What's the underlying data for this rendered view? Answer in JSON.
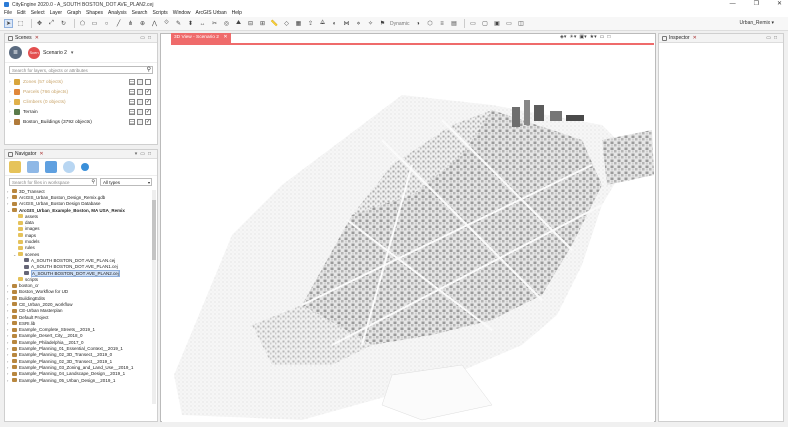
{
  "window": {
    "title": "CityEngine 2020.0 - A_SOUTH BOSTON_DOT AVE_PLAN2.cej",
    "minimize": "—",
    "maximize": "❐",
    "close": "✕"
  },
  "menu": [
    "File",
    "Edit",
    "Select",
    "Layer",
    "Graph",
    "Shapes",
    "Analysis",
    "Search",
    "Scripts",
    "Window",
    "ArcGIS Urban",
    "Help"
  ],
  "toolbar": {
    "dynamic_label": "Dynamic",
    "user_label": "Urban_Remix ▾"
  },
  "scenes_panel": {
    "title": "Scenes",
    "badge": "Scen",
    "scenario": "Scenario 2",
    "search_placeholder": "Search for layers, objects or attributes",
    "layers": [
      {
        "name": "Zones (57 objects)",
        "dim": true,
        "color": "#d8a53c"
      },
      {
        "name": "Parcels (766 objects)",
        "dim": true,
        "color": "#e0873a"
      },
      {
        "name": "Climbers (0 objects)",
        "dim": true,
        "color": "#e0b04a"
      },
      {
        "name": "Terrain",
        "dim": false,
        "color": "#5a7a4a"
      },
      {
        "name": "Boston_Buildings (3792 objects)",
        "dim": false,
        "color": "#b07a3a"
      }
    ]
  },
  "navigator_panel": {
    "title": "Navigator",
    "search_placeholder": "Search for files in workspace",
    "filter": "All types",
    "tree": [
      {
        "label": "3D_Transect",
        "level": 0,
        "exp": "›",
        "icon": "proj"
      },
      {
        "label": "ArcGIS_Urban_Boston_Design_Remix.gdb",
        "level": 0,
        "exp": "›",
        "icon": "proj"
      },
      {
        "label": "ArcGIS_Urban_Boston Design Database",
        "level": 0,
        "exp": "›",
        "icon": "proj"
      },
      {
        "label": "ArcGIS_Urban_Example_Boston, MA USA_Remix",
        "level": 0,
        "exp": "⌄",
        "icon": "proj",
        "bold": true
      },
      {
        "label": "assets",
        "level": 1,
        "exp": "",
        "icon": "folder"
      },
      {
        "label": "data",
        "level": 1,
        "exp": "",
        "icon": "folder"
      },
      {
        "label": "images",
        "level": 1,
        "exp": "",
        "icon": "folder"
      },
      {
        "label": "maps",
        "level": 1,
        "exp": "",
        "icon": "folder"
      },
      {
        "label": "models",
        "level": 1,
        "exp": "",
        "icon": "folder"
      },
      {
        "label": "rules",
        "level": 1,
        "exp": "",
        "icon": "folder"
      },
      {
        "label": "scenes",
        "level": 1,
        "exp": "⌄",
        "icon": "folder"
      },
      {
        "label": "A_SOUTH BOSTON_DOT AVE_PLAN.cej",
        "level": 2,
        "exp": "",
        "icon": "file"
      },
      {
        "label": "A_SOUTH BOSTON_DOT AVE_PLAN1.cej",
        "level": 2,
        "exp": "",
        "icon": "file"
      },
      {
        "label": "A_SOUTH BOSTON_DOT AVE_PLAN2.cej",
        "level": 2,
        "exp": "",
        "icon": "file",
        "selected": true
      },
      {
        "label": "scripts",
        "level": 1,
        "exp": "",
        "icon": "folder"
      },
      {
        "label": "boston_cr",
        "level": 0,
        "exp": "›",
        "icon": "proj"
      },
      {
        "label": "Boston_Workflow for UD",
        "level": 0,
        "exp": "›",
        "icon": "proj"
      },
      {
        "label": "BuildingEdits",
        "level": 0,
        "exp": "›",
        "icon": "proj"
      },
      {
        "label": "CE_Urban_2020_workflow",
        "level": 0,
        "exp": "›",
        "icon": "proj"
      },
      {
        "label": "CE-Urban Masterplan",
        "level": 0,
        "exp": "›",
        "icon": "proj"
      },
      {
        "label": "Default Project",
        "level": 0,
        "exp": "›",
        "icon": "proj"
      },
      {
        "label": "ESRI.lib",
        "level": 0,
        "exp": "›",
        "icon": "proj"
      },
      {
        "label": "Example_Complete_Streets__2019_1",
        "level": 0,
        "exp": "›",
        "icon": "proj"
      },
      {
        "label": "Example_Desert_City__2018_0",
        "level": 0,
        "exp": "›",
        "icon": "proj"
      },
      {
        "label": "Example_Philadelphia__2017_0",
        "level": 0,
        "exp": "›",
        "icon": "proj"
      },
      {
        "label": "Example_Planning_01_Essential_Context__2019_1",
        "level": 0,
        "exp": "›",
        "icon": "proj"
      },
      {
        "label": "Example_Planning_02_3D_Transect__2019_0",
        "level": 0,
        "exp": "›",
        "icon": "proj"
      },
      {
        "label": "Example_Planning_02_3D_Transect__2019_1",
        "level": 0,
        "exp": "›",
        "icon": "proj"
      },
      {
        "label": "Example_Planning_03_Zoning_and_Land_Use__2019_1",
        "level": 0,
        "exp": "›",
        "icon": "proj"
      },
      {
        "label": "Example_Planning_04_Landscape_Design__2019_1",
        "level": 0,
        "exp": "›",
        "icon": "proj"
      },
      {
        "label": "Example_Planning_05_Urban_Design__2019_1",
        "level": 0,
        "exp": "›",
        "icon": "proj"
      }
    ]
  },
  "viewport": {
    "tab_label": "3D View - Scenario 2"
  },
  "inspector": {
    "title": "Inspector"
  }
}
